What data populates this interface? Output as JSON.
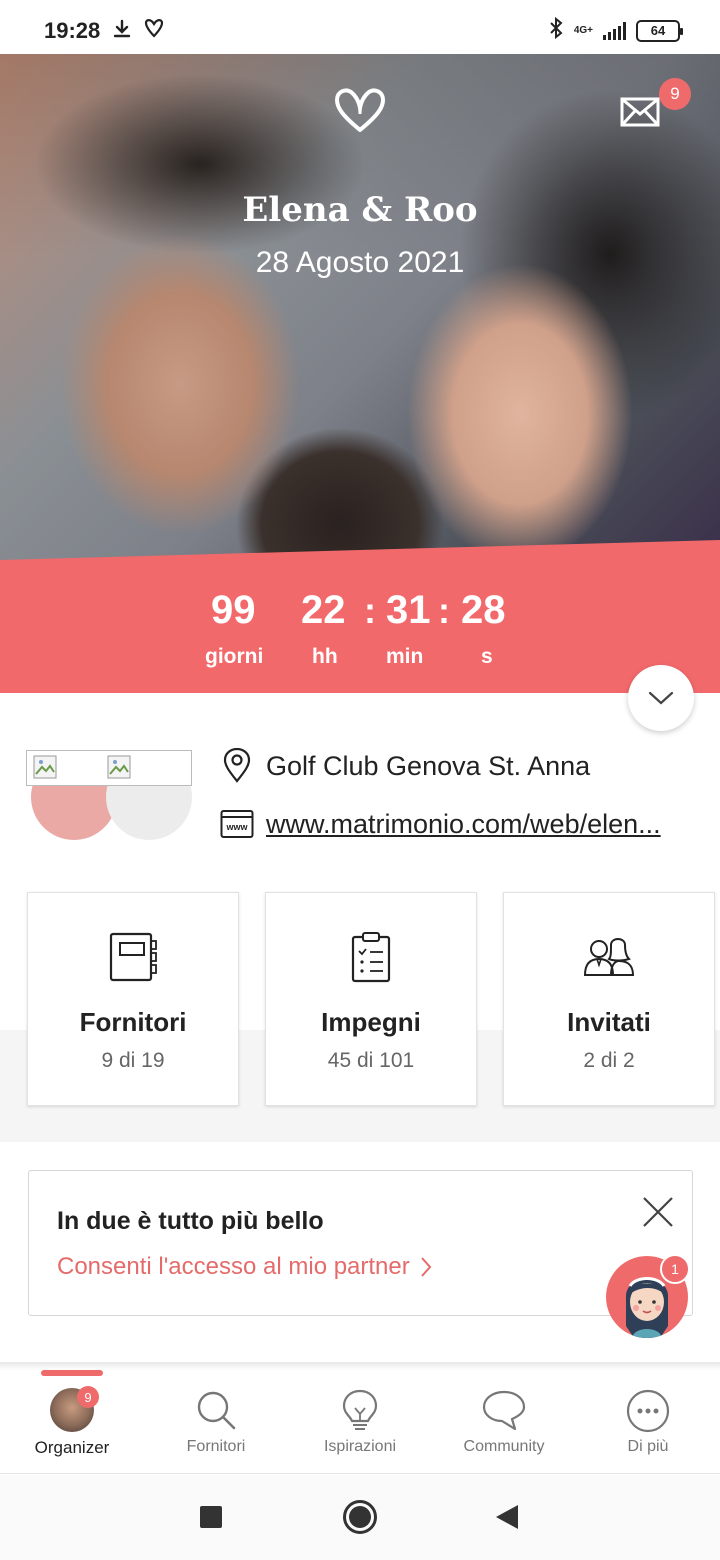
{
  "status_bar": {
    "time": "19:28",
    "network": "4G+",
    "battery": "64",
    "icons": [
      "download-icon",
      "heart-outline-icon",
      "bluetooth-icon",
      "signal-icon",
      "battery-icon"
    ]
  },
  "hero": {
    "title": "Elena & Roo",
    "date": "28 Agosto 2021",
    "mail_badge": "9",
    "icons": [
      "heart-logo-icon",
      "mail-icon"
    ]
  },
  "countdown": {
    "days": "99",
    "hours": "22",
    "minutes": "31",
    "seconds": "28",
    "separator": ":",
    "days_label": "giorni",
    "hours_label": "hh",
    "minutes_label": "min",
    "seconds_label": "s",
    "accent_color": "#f2696b"
  },
  "info": {
    "venue": "Golf Club Genova St. Anna",
    "website": "www.matrimonio.com/web/elen..."
  },
  "cards": [
    {
      "title": "Fornitori",
      "subtitle": "9 di 19",
      "icon": "notebook-icon"
    },
    {
      "title": "Impegni",
      "subtitle": "45 di 101",
      "icon": "checklist-icon"
    },
    {
      "title": "Invitati",
      "subtitle": "2 di 2",
      "icon": "guests-icon"
    }
  ],
  "promo": {
    "title": "In due è tutto più bello",
    "link": "Consenti l'accesso al mio partner",
    "assistant_badge": "1"
  },
  "bottom_nav": {
    "items": [
      {
        "label": "Organizer",
        "badge": "9",
        "active": true
      },
      {
        "label": "Fornitori"
      },
      {
        "label": "Ispirazioni"
      },
      {
        "label": "Community"
      },
      {
        "label": "Di più"
      }
    ]
  }
}
